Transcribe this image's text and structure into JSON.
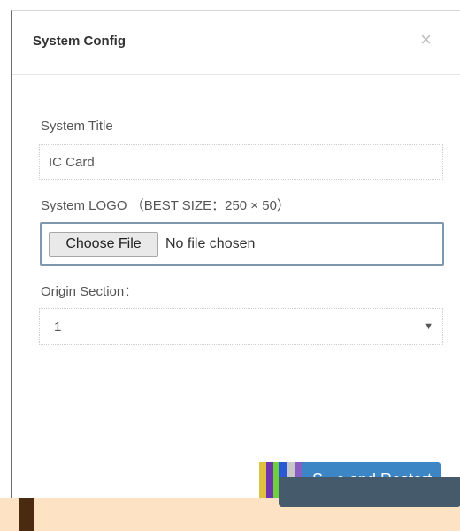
{
  "dialog": {
    "title": "System Config",
    "close_symbol": "×"
  },
  "form": {
    "system_title": {
      "label": "System Title",
      "value": "IC Card"
    },
    "system_logo": {
      "label": "System LOGO （BEST SIZE：250 × 50）",
      "button_label": "Choose File",
      "status": "No file chosen"
    },
    "origin_section": {
      "label": "Origin Section：",
      "value": "1",
      "arrow": "▼"
    }
  },
  "footer": {
    "save_label": "S...e and Restart"
  },
  "colors": {
    "primary_button": "#3c86c6",
    "tooltip_bg": "#455a6b",
    "file_border": "#7f97ac"
  }
}
